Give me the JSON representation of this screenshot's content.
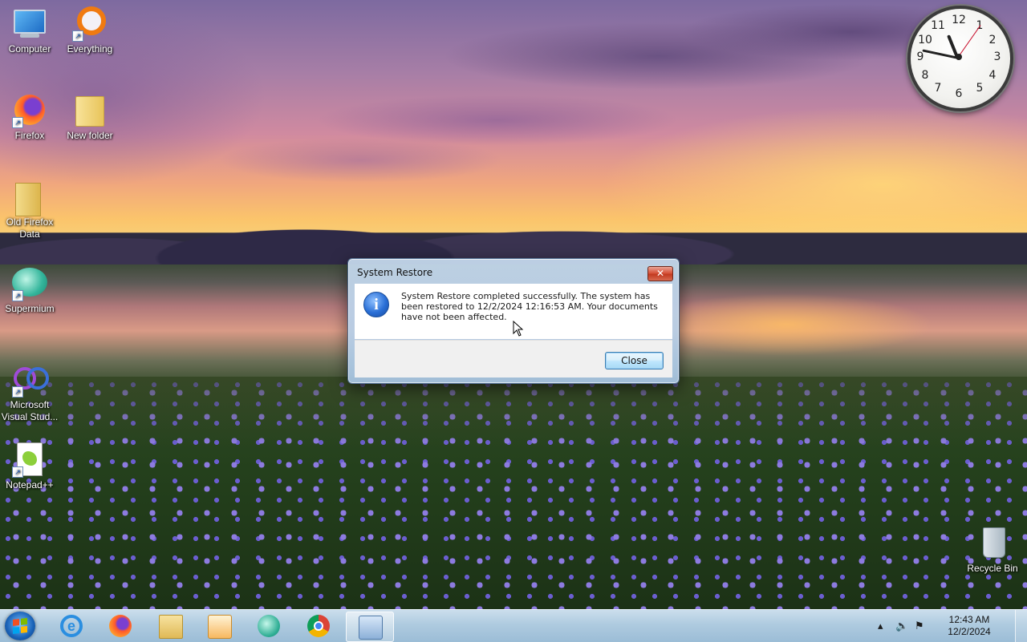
{
  "desktop": {
    "icons": [
      {
        "label": "Computer",
        "icon": "computer-icon"
      },
      {
        "label": "Everything",
        "icon": "everything-icon"
      },
      {
        "label": "Firefox",
        "icon": "firefox-icon"
      },
      {
        "label": "New folder",
        "icon": "folder-icon"
      },
      {
        "label": "Old Firefox Data",
        "icon": "folder-icon"
      },
      {
        "label": "Supermium",
        "icon": "supermium-icon"
      },
      {
        "label": "Microsoft Visual Stud...",
        "icon": "visual-studio-icon"
      },
      {
        "label": "Notepad++",
        "icon": "notepadpp-icon"
      },
      {
        "label": "Recycle Bin",
        "icon": "recycle-bin-icon"
      }
    ]
  },
  "clock_gadget": {
    "numbers": [
      "12",
      "1",
      "2",
      "3",
      "4",
      "5",
      "6",
      "7",
      "8",
      "9",
      "10",
      "11"
    ],
    "time": "12:43"
  },
  "dialog": {
    "title": "System Restore",
    "close_glyph": "✕",
    "info_glyph": "i",
    "message": "System Restore completed successfully. The system has been restored to 12/2/2024 12:16:53 AM. Your documents have not been affected.",
    "button_label": "Close"
  },
  "taskbar": {
    "pinned": [
      {
        "name": "internet-explorer",
        "icon": "ie-icon"
      },
      {
        "name": "firefox",
        "icon": "firefox-icon"
      },
      {
        "name": "file-explorer",
        "icon": "folder-icon"
      },
      {
        "name": "media-player",
        "icon": "media-player-icon"
      },
      {
        "name": "supermium",
        "icon": "supermium-icon"
      },
      {
        "name": "chrome",
        "icon": "chrome-icon"
      },
      {
        "name": "system-restore",
        "icon": "system-restore-icon",
        "active": true
      }
    ],
    "tray": {
      "time": "12:43 AM",
      "date": "12/2/2024"
    }
  }
}
